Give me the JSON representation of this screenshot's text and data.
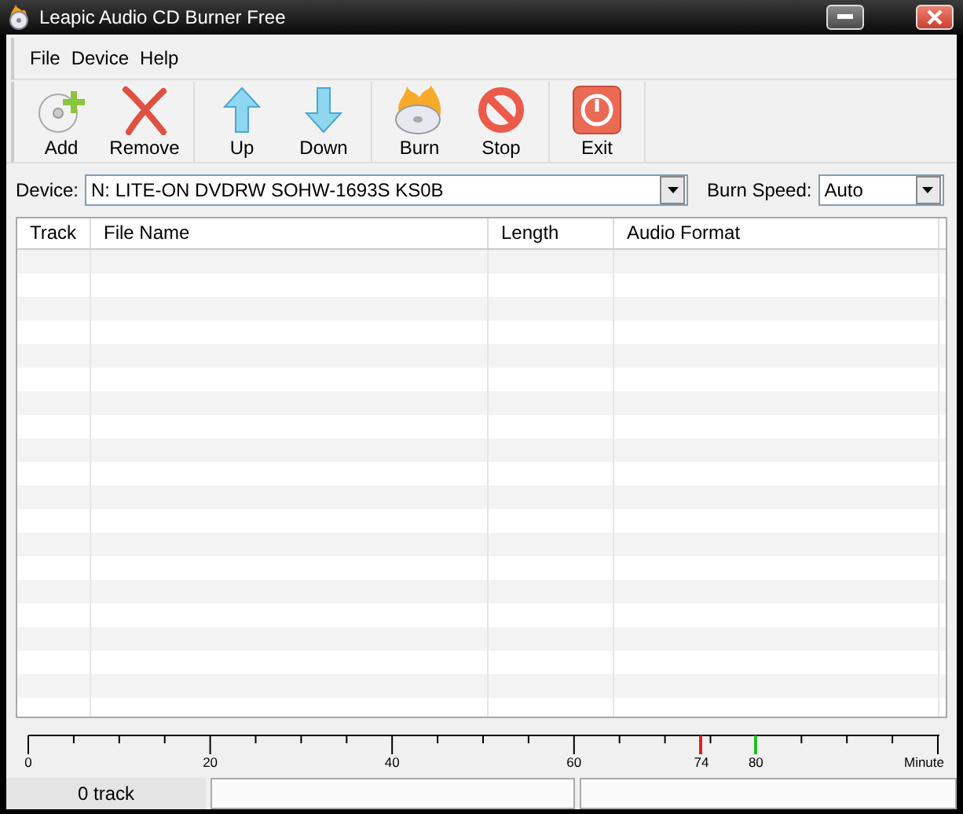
{
  "window": {
    "title": "Leapic Audio CD Burner Free"
  },
  "menu": [
    "File",
    "Device",
    "Help"
  ],
  "toolbar": [
    {
      "kind": "add",
      "label": "Add"
    },
    {
      "kind": "remove",
      "label": "Remove"
    },
    {
      "kind": "up",
      "label": "Up"
    },
    {
      "kind": "down",
      "label": "Down"
    },
    {
      "kind": "burn",
      "label": "Burn"
    },
    {
      "kind": "stop",
      "label": "Stop"
    },
    {
      "kind": "exit",
      "label": "Exit"
    }
  ],
  "device": {
    "label": "Device:",
    "value": "N: LITE-ON DVDRW SOHW-1693S KS0B"
  },
  "burn_speed": {
    "label": "Burn Speed:",
    "value": "Auto"
  },
  "table": {
    "columns": [
      "Track",
      "File Name",
      "Length",
      "Audio Format"
    ]
  },
  "ruler": {
    "labels": [
      {
        "text": "0"
      },
      {
        "text": "20"
      },
      {
        "text": "40"
      },
      {
        "text": "60"
      },
      {
        "text": "74",
        "color": "#e02020"
      },
      {
        "text": "80",
        "color": "#20c020"
      },
      {
        "text": "Minute"
      }
    ]
  },
  "status_bar": {
    "tracks": "0 track"
  }
}
